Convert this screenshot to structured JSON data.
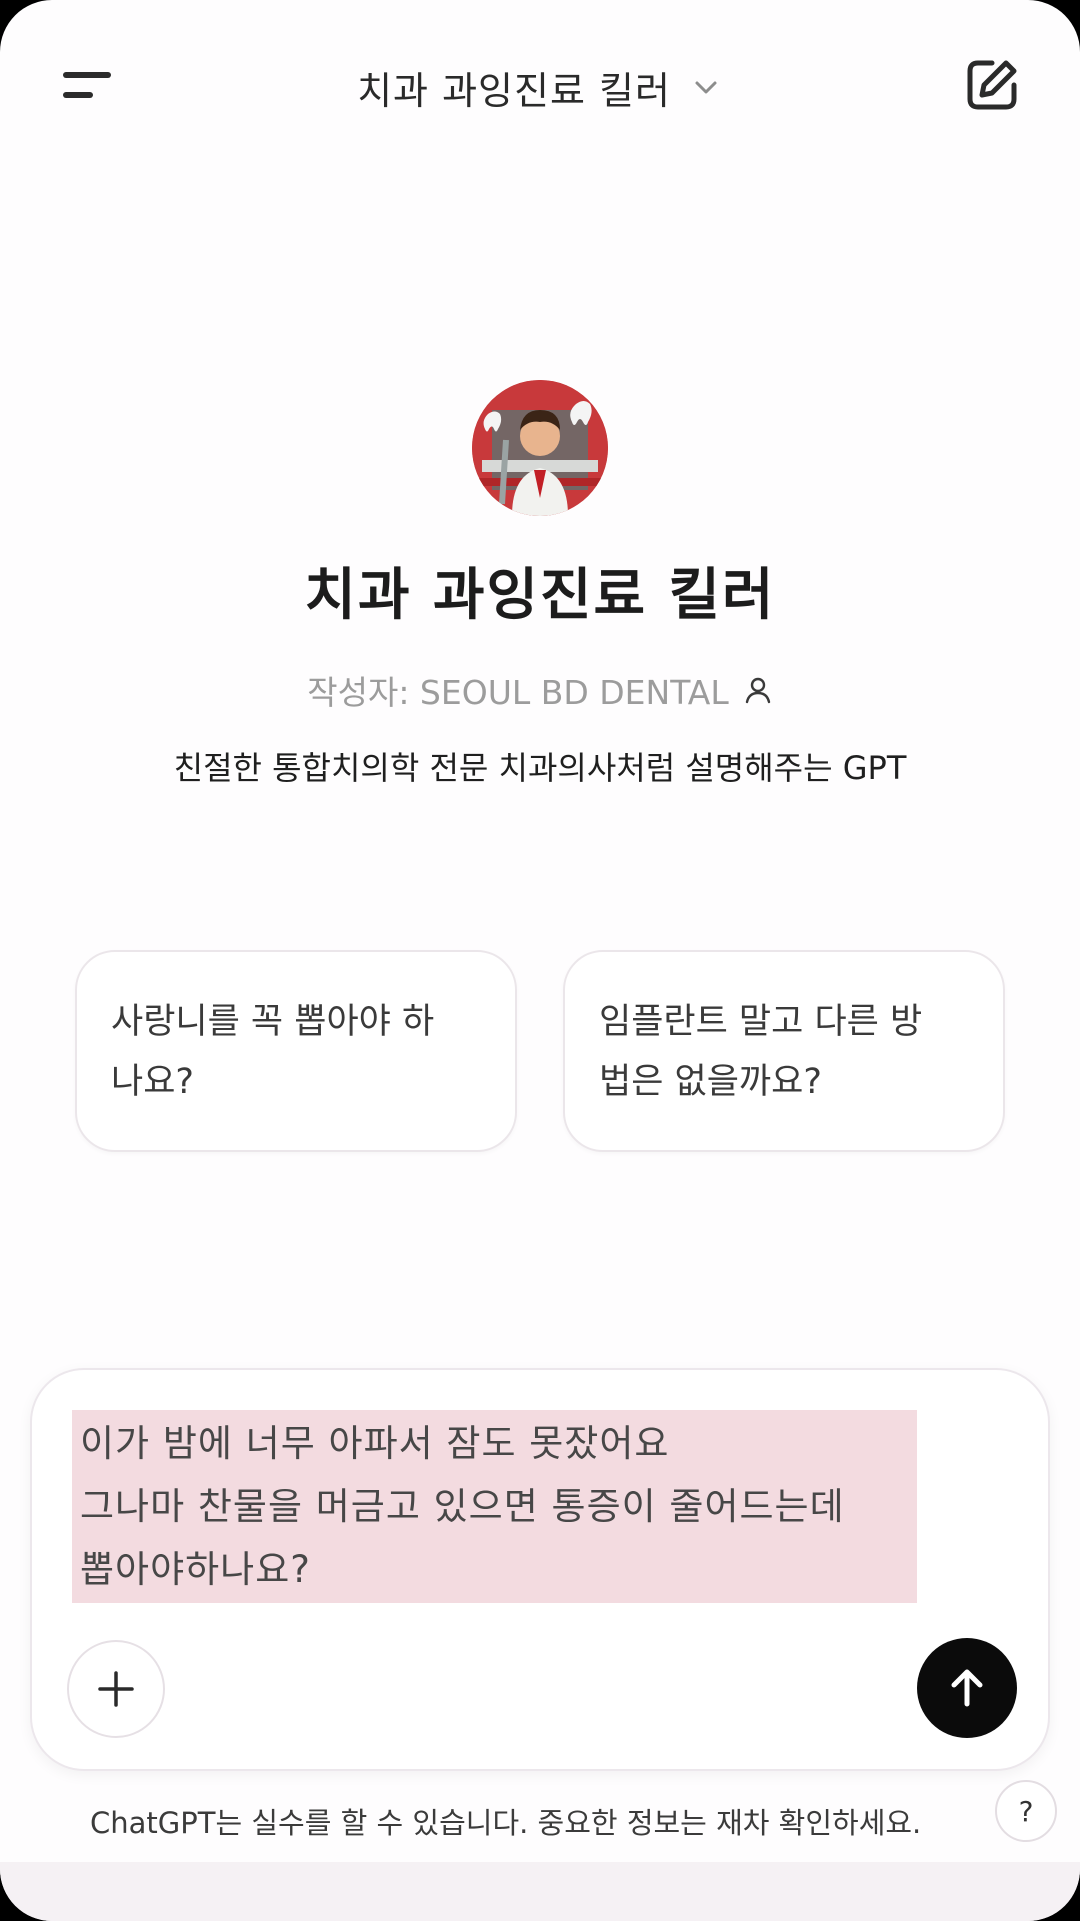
{
  "header": {
    "title": "치과 과잉진료 킬러"
  },
  "gpt": {
    "name": "치과 과잉진료 킬러",
    "author": "작성자: SEOUL BD DENTAL",
    "description": "친절한 통합치의학 전문 치과의사처럼 설명해주는 GPT"
  },
  "suggestions": [
    {
      "line1": "사랑니를 꼭 뽑아야 하",
      "line2": "나요?"
    },
    {
      "line1": "임플란트 말고 다른 방",
      "line2": "법은 없을까요?"
    }
  ],
  "composer": {
    "lines": [
      "이가 밤에 너무 아파서 잠도 못잤어요",
      "그나마 찬물을 머금고 있으면 통증이 줄어드는데",
      "뽑아야하나요?"
    ]
  },
  "footer": {
    "disclaimer": "ChatGPT는 실수를 할 수 있습니다. 중요한 정보는 재차 확인하세요.",
    "help_label": "?"
  },
  "icons": {
    "menu": "menu-icon",
    "title_dropdown": "chevron-down-icon",
    "new_chat": "edit-icon",
    "author": "person-icon",
    "attach": "plus-icon",
    "send": "arrow-up-icon"
  },
  "colors": {
    "background": "#fefdfe",
    "text_highlight": "#f3dbe0",
    "send_button": "#0b0b0b"
  }
}
